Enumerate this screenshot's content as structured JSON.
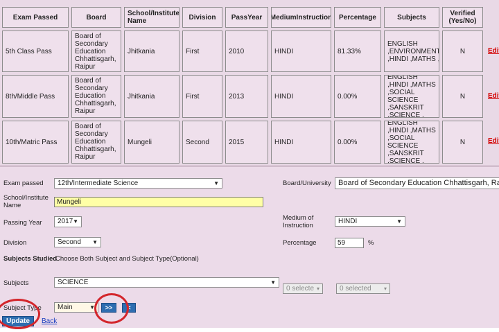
{
  "table": {
    "headers": [
      "Exam Passed",
      "Board",
      "School/Institute Name",
      "Division",
      "PassYear",
      "MediumInstruction",
      "Percentage",
      "Subjects",
      "Verified (Yes/No)"
    ],
    "edit_label": "Edit",
    "rows": [
      {
        "exam": "5th Class Pass",
        "board": "Board of Secondary Education Chhattisgarh, Raipur",
        "school": "Jhitkania",
        "division": "First",
        "year": "2010",
        "medium": "HINDI",
        "percentage": "81.33%",
        "subjects": "ENGLISH ,ENVIRONMENT ,HINDI ,MATHS ,",
        "verified": "N"
      },
      {
        "exam": "8th/Middle Pass",
        "board": "Board of Secondary Education Chhattisgarh, Raipur",
        "school": "Jhitkania",
        "division": "First",
        "year": "2013",
        "medium": "HINDI",
        "percentage": "0.00%",
        "subjects": "ENGLISH ,HINDI ,MATHS ,SOCIAL SCIENCE ,SANSKRIT ,SCIENCE ,",
        "verified": "N"
      },
      {
        "exam": "10th/Matric Pass",
        "board": "Board of Secondary Education Chhattisgarh, Raipur",
        "school": "Mungeli",
        "division": "Second",
        "year": "2015",
        "medium": "HINDI",
        "percentage": "0.00%",
        "subjects": "ENGLISH ,HINDI ,MATHS ,SOCIAL SCIENCE ,SANSKRIT ,SCIENCE ,",
        "verified": "N"
      }
    ]
  },
  "form": {
    "exam_passed_label": "Exam passed",
    "exam_passed_value": "12th/Intermediate Science",
    "board_label": "Board/University",
    "board_value": "Board of Secondary Education Chhattisgarh, Raipur",
    "school_label": "School/Institute Name",
    "school_value": "Mungeli",
    "passing_year_label": "Passing Year",
    "passing_year_value": "2017",
    "medium_label": "Medium of Instruction",
    "medium_value": "HINDI",
    "division_label": "Division",
    "division_value": "Second",
    "percentage_label": "Percentage",
    "percentage_value": "59",
    "percent_sign": "%",
    "subjects_studied_label": "Subjects Studied",
    "subjects_studied_hint": "Choose Both Subject and Subject Type(Optional)",
    "subjects_label": "Subjects",
    "subjects_value": "SCIENCE",
    "selected_left": "0 selecte",
    "selected_right": "0 selected",
    "subject_type_label": "Subject Type",
    "subject_type_value": "Main",
    "add_button": ">>",
    "remove_button": "<",
    "update_button": "Update",
    "back_link": "Back"
  }
}
